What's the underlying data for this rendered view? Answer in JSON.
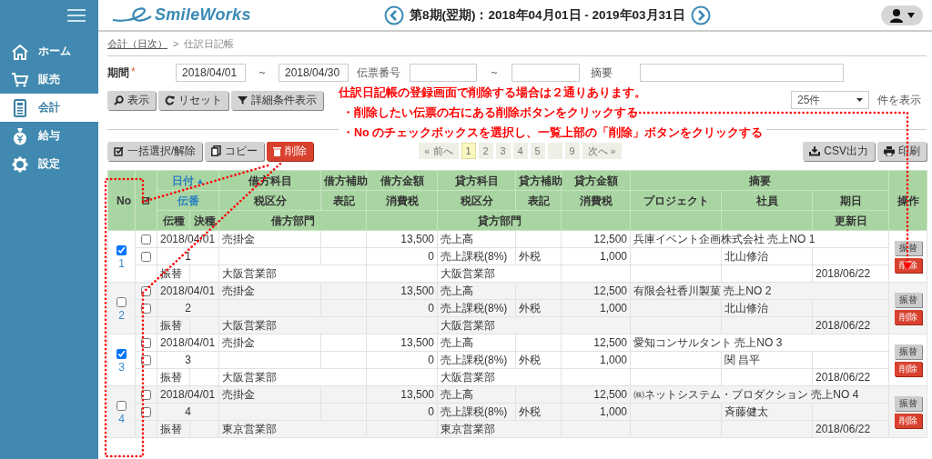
{
  "sidebar": {
    "items": [
      {
        "label": "ホーム",
        "selected": false
      },
      {
        "label": "販売",
        "selected": false
      },
      {
        "label": "会計",
        "selected": true
      },
      {
        "label": "給与",
        "selected": false
      },
      {
        "label": "設定",
        "selected": false
      }
    ]
  },
  "header": {
    "logo": "SmileWorks",
    "period": "第8期(翌期)：2018年04月01日 - 2019年03月31日"
  },
  "breadcrumb": {
    "parent": "会計（日次）",
    "separator": ">",
    "current": "仕訳日記帳"
  },
  "filters": {
    "period_label": "期間",
    "required_mark": "*",
    "date_from": "2018/04/01",
    "range_sep_1": "~",
    "date_to": "2018/04/30",
    "slip_no_label": "伝票番号",
    "range_sep_2": "~",
    "summary_label": "摘要"
  },
  "search_buttons": [
    "表示",
    "リセット",
    "詳細条件表示"
  ],
  "page_size": {
    "value": "25件",
    "suffix": "件を表示"
  },
  "list_buttons": [
    {
      "label": "一括選択/解除",
      "kind": "default"
    },
    {
      "label": "コピー",
      "kind": "default"
    },
    {
      "label": "削除",
      "kind": "danger"
    }
  ],
  "pagination": [
    {
      "label": "« 前へ",
      "kind": "nav",
      "selected": false
    },
    {
      "label": "1",
      "kind": "page",
      "selected": true
    },
    {
      "label": "2",
      "kind": "page",
      "selected": false
    },
    {
      "label": "3",
      "kind": "page",
      "selected": false
    },
    {
      "label": "4",
      "kind": "page",
      "selected": false
    },
    {
      "label": "5",
      "kind": "page",
      "selected": false
    },
    {
      "kind": "gap",
      "selected": false
    },
    {
      "label": "9",
      "kind": "page",
      "selected": false
    },
    {
      "label": "次へ »",
      "kind": "nav",
      "selected": false
    }
  ],
  "export_buttons": [
    "CSV出力",
    "印刷"
  ],
  "table": {
    "columns": {
      "no": "No",
      "date": "日付",
      "debit_account": "借方科目",
      "debit_sub": "借方補助",
      "debit_amount": "借方金額",
      "credit_account": "貸方科目",
      "credit_sub": "貸方補助",
      "credit_amount": "貸方金額",
      "summary": "摘要",
      "ops": "操作",
      "slip_no": "伝番",
      "debit_tax_class": "税区分",
      "debit_notation": "表記",
      "debit_tax": "消費税",
      "credit_tax_class": "税区分",
      "credit_notation": "表記",
      "credit_tax": "消費税",
      "project": "プロジェクト",
      "employee": "社員",
      "due": "期日",
      "slip_type": "伝種",
      "settle_type": "決種",
      "debit_dept": "借方部門",
      "credit_dept": "貸方部門",
      "updated": "更新日"
    },
    "date_sort": "▲",
    "entries": [
      {
        "no": "1",
        "selected": true,
        "line_checks": [
          false,
          false
        ],
        "date": "2018/04/01",
        "debit_account": "売掛金",
        "debit_amount": "13,500",
        "credit_account": "売上高",
        "credit_amount": "12,500",
        "summary": "兵庫イベント企画株式会社 売上NO 1",
        "slip_no": "1",
        "debit_tax": "0",
        "credit_tax_class": "売上課税(8%)",
        "credit_notation": "外税",
        "credit_tax": "1,000",
        "employee": "北山修治",
        "slip_type": "振替",
        "debit_dept": "大阪営業部",
        "credit_dept": "大阪営業部",
        "updated": "2018/06/22",
        "actions": [
          "振替",
          "削除"
        ]
      },
      {
        "no": "2",
        "selected": false,
        "line_checks": [
          false,
          false
        ],
        "date": "2018/04/01",
        "debit_account": "売掛金",
        "debit_amount": "13,500",
        "credit_account": "売上高",
        "credit_amount": "12,500",
        "summary": "有限会社香川製菓 売上NO 2",
        "slip_no": "2",
        "debit_tax": "0",
        "credit_tax_class": "売上課税(8%)",
        "credit_notation": "外税",
        "credit_tax": "1,000",
        "employee": "北山修治",
        "slip_type": "振替",
        "debit_dept": "大阪営業部",
        "credit_dept": "大阪営業部",
        "updated": "2018/06/22",
        "actions": [
          "振替",
          "削除"
        ]
      },
      {
        "no": "3",
        "selected": true,
        "line_checks": [
          false,
          false
        ],
        "date": "2018/04/01",
        "debit_account": "売掛金",
        "debit_amount": "13,500",
        "credit_account": "売上高",
        "credit_amount": "12,500",
        "summary": "愛知コンサルタント 売上NO 3",
        "slip_no": "3",
        "debit_tax": "0",
        "credit_tax_class": "売上課税(8%)",
        "credit_notation": "外税",
        "credit_tax": "1,000",
        "employee": "関 昌平",
        "slip_type": "振替",
        "debit_dept": "大阪営業部",
        "credit_dept": "大阪営業部",
        "updated": "2018/06/22",
        "actions": [
          "振替",
          "削除"
        ]
      },
      {
        "no": "4",
        "selected": false,
        "line_checks": [
          false,
          false
        ],
        "date": "2018/04/01",
        "debit_account": "売掛金",
        "debit_amount": "13,500",
        "credit_account": "売上高",
        "credit_amount": "12,500",
        "summary": "㈱ネットシステム・プロダクション 売上NO 4",
        "slip_no": "4",
        "debit_tax": "0",
        "credit_tax_class": "売上課税(8%)",
        "credit_notation": "外税",
        "credit_tax": "1,000",
        "employee": "斉藤健太",
        "slip_type": "振替",
        "debit_dept": "東京営業部",
        "credit_dept": "東京営業部",
        "updated": "2018/06/22",
        "actions": [
          "振替",
          "削除"
        ]
      }
    ]
  },
  "annotation": {
    "lines": [
      "仕訳日記帳の登録画面で削除する場合は２通りあります。",
      "・削除したい伝票の右にある削除ボタンをクリックする",
      "・No のチェックボックスを選択し、一覧上部の「削除」ボタンをクリックする"
    ]
  }
}
